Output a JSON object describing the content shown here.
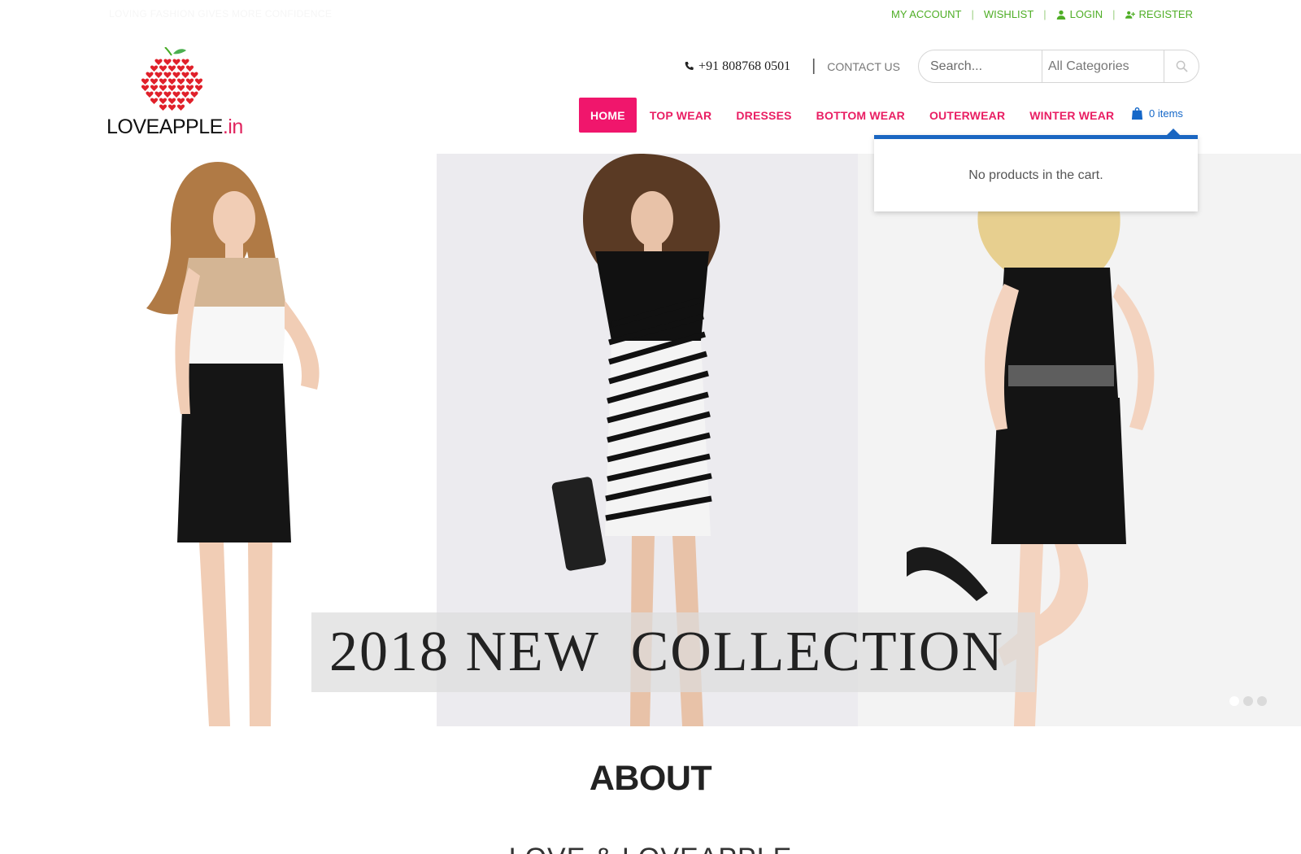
{
  "topbar": {
    "tagline": "LOVING FASHION GIVES MORE CONFIDENCE",
    "links": {
      "my_account": "MY ACCOUNT",
      "wishlist": "WISHLIST",
      "login": "LOGIN",
      "register": "REGISTER"
    },
    "separator": "|"
  },
  "logo": {
    "wordmark": "LOVEAPPLE",
    "suffix": ".in"
  },
  "header": {
    "phone": "+91 808768 0501",
    "separator": "|",
    "contact_us": "CONTACT US",
    "search_placeholder": "Search...",
    "category_select": "All Categories"
  },
  "nav": {
    "items": [
      "HOME",
      "TOP WEAR",
      "DRESSES",
      "BOTTOM WEAR",
      "OUTERWEAR",
      "WINTER WEAR"
    ],
    "active_index": 0
  },
  "cart": {
    "label": "0 items",
    "empty_message": "No products in the cart."
  },
  "hero": {
    "caption": "2018 NEW  COLLECTION",
    "slide_count": 3,
    "active_slide": 1
  },
  "about": {
    "title": "ABOUT",
    "subtitle": "LOVE & LOVEAPPLE"
  },
  "colors": {
    "accent_pink": "#f0166c",
    "nav_text": "#e91e63",
    "topbar_green": "#4fae26",
    "cart_blue": "#1467c8"
  },
  "icons": {
    "user": "user-icon",
    "user_plus": "user-plus-icon",
    "phone": "phone-icon",
    "search": "search-icon",
    "cart": "shopping-bag-icon"
  }
}
